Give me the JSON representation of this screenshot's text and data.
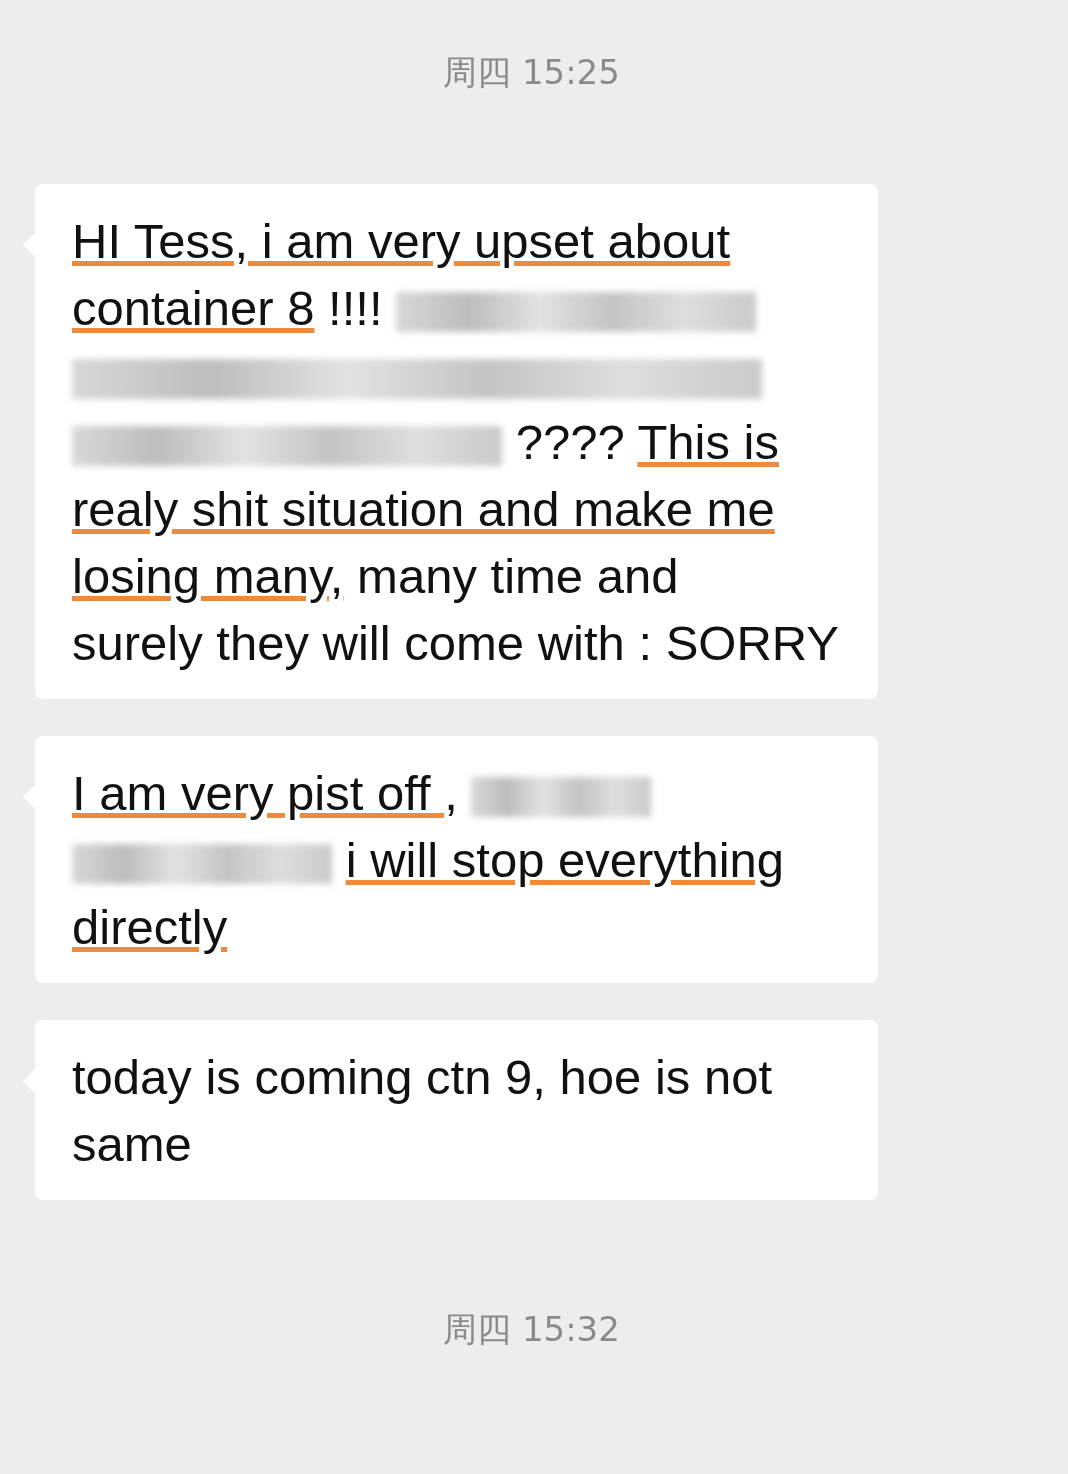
{
  "items": [
    {
      "kind": "time",
      "text": "周四 15:25"
    },
    {
      "kind": "message",
      "segments": [
        {
          "kind": "text",
          "text": "HI Tess, i am very upset about",
          "underlined": true
        },
        {
          "kind": "text",
          "text": "container 8",
          "underlined": true
        },
        {
          "kind": "text",
          "text": "!!!!",
          "underlined": false
        },
        {
          "kind": "blur"
        },
        {
          "kind": "blur"
        },
        {
          "kind": "blur"
        },
        {
          "kind": "text",
          "text": "????",
          "underlined": false
        },
        {
          "kind": "text",
          "text": "This is",
          "underlined": true
        },
        {
          "kind": "text",
          "text": "realy shit situation and make me",
          "underlined": true
        },
        {
          "kind": "text",
          "text": "losing many,",
          "underlined": true
        },
        {
          "kind": "text",
          "text": "many time and",
          "underlined": false
        },
        {
          "kind": "text",
          "text": "surely they will come with :",
          "underlined": false
        },
        {
          "kind": "text",
          "text": "SORRY",
          "underlined": false
        }
      ]
    },
    {
      "kind": "message",
      "segments": [
        {
          "kind": "text",
          "text": "I am very pist off ,",
          "underlined": true
        },
        {
          "kind": "blur"
        },
        {
          "kind": "blur"
        },
        {
          "kind": "text",
          "text": "i will stop everything",
          "underlined": true
        },
        {
          "kind": "text",
          "text": "directly",
          "underlined": true
        }
      ]
    },
    {
      "kind": "message",
      "segments": [
        {
          "kind": "text",
          "text": "today is coming ctn 9, hoe is not",
          "underlined": false
        },
        {
          "kind": "text",
          "text": "same",
          "underlined": false
        }
      ]
    },
    {
      "kind": "time",
      "text": "周四 15:32"
    }
  ]
}
